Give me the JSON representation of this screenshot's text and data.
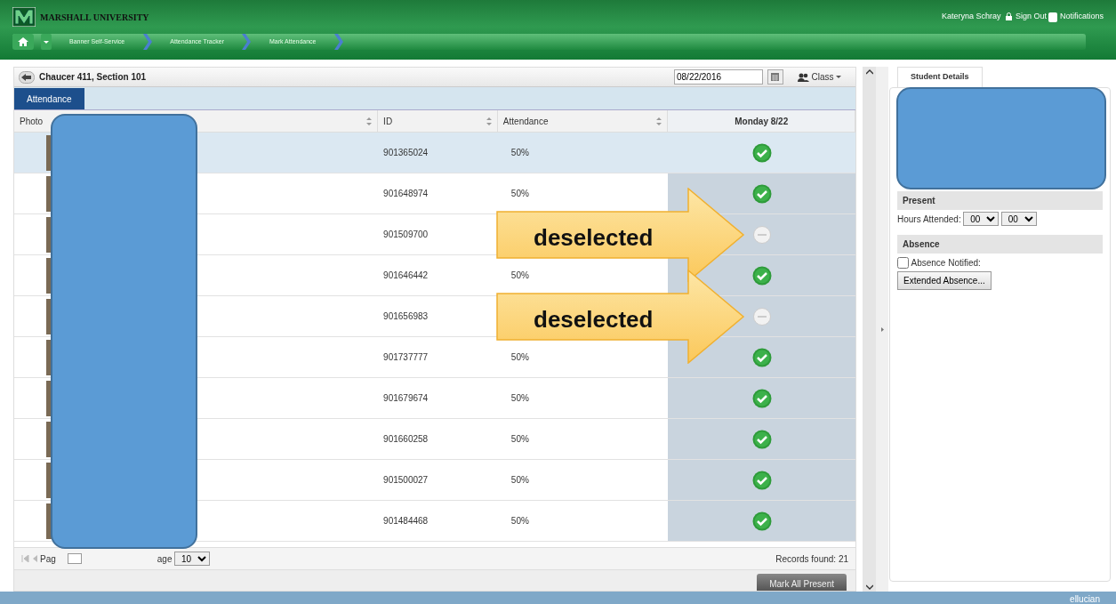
{
  "header": {
    "university": "MARSHALL UNIVERSITY",
    "user": "Kateryna Schray",
    "sign_out": "Sign Out",
    "notifications": "Notifications",
    "breadcrumbs": [
      "Banner Self-Service",
      "Attendance Tracker",
      "Mark Attendance"
    ]
  },
  "course": {
    "title": "Chaucer 411, Section 101",
    "date": "08/22/2016",
    "view": "Class"
  },
  "tabs": [
    {
      "label": "Attendance",
      "selected": true
    }
  ],
  "table": {
    "names_redacted": true,
    "columns": [
      {
        "label": "Photo",
        "sortable": true
      },
      {
        "label": "ID",
        "sortable": true
      },
      {
        "label": "Attendance",
        "sortable": true
      },
      {
        "label": "Monday 8/22",
        "sortable": false
      }
    ],
    "rows": [
      {
        "id": "901365024",
        "attendance": "50%",
        "present": true,
        "selected": true
      },
      {
        "id": "901648974",
        "attendance": "50%",
        "present": true,
        "selected": false
      },
      {
        "id": "901509700",
        "present": false,
        "selected": false,
        "callout": "deselected"
      },
      {
        "id": "901646442",
        "attendance": "50%",
        "present": true,
        "selected": false
      },
      {
        "id": "901656983",
        "present": false,
        "selected": false,
        "callout": "deselected"
      },
      {
        "id": "901737777",
        "attendance": "50%",
        "present": true,
        "selected": false
      },
      {
        "id": "901679674",
        "attendance": "50%",
        "present": true,
        "selected": false
      },
      {
        "id": "901660258",
        "attendance": "50%",
        "present": true,
        "selected": false
      },
      {
        "id": "901500027",
        "attendance": "50%",
        "present": true,
        "selected": false
      },
      {
        "id": "901484468",
        "attendance": "50%",
        "present": true,
        "selected": false
      }
    ]
  },
  "pager": {
    "page_label_start": "Pag",
    "page_label_end": "age",
    "per_page": "10",
    "records": "Records found: 21"
  },
  "actions": {
    "mark_all": "Mark All Present"
  },
  "details": {
    "student_redacted": true,
    "tab": "Student Details",
    "present_heading": "Present",
    "hours_label": "Hours Attended:",
    "hours": "00",
    "minutes": "00",
    "absence_heading": "Absence",
    "absence_notified": {
      "label": "Absence Notified:",
      "checked": false
    },
    "extended_button": "Extended Absence..."
  },
  "footer": {
    "brand": "ellucian"
  }
}
